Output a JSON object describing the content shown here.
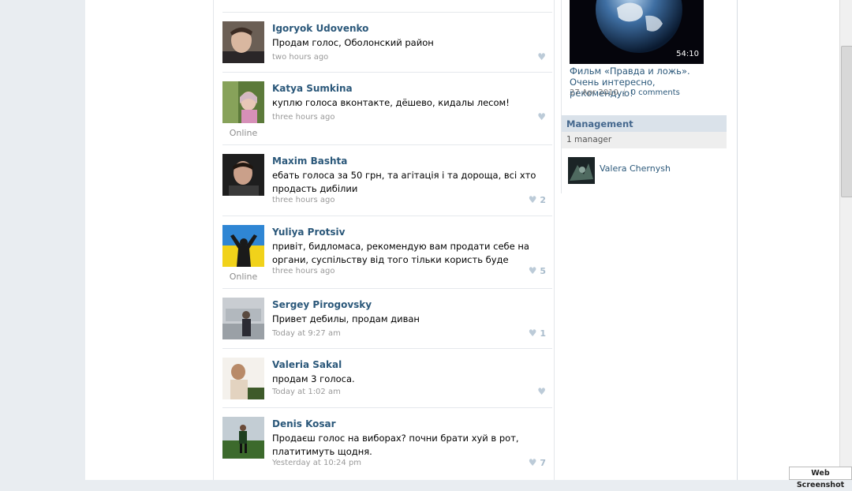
{
  "posts": [
    {
      "name": "Igoryok Udovenko",
      "text": "Продам голос, Оболонский район",
      "time": "two hours ago",
      "online": "",
      "likes": ""
    },
    {
      "name": "Katya Sumkina",
      "text": "куплю голоса вконтакте, дёшево, кидалы лесом!",
      "time": "three hours ago",
      "online": "Online",
      "likes": ""
    },
    {
      "name": "Maxim Bashta",
      "text": "ебать голоса за 50 грн, та агітація і та дороща, всі хто продасть дибілии",
      "time": "three hours ago",
      "online": "",
      "likes": "2"
    },
    {
      "name": "Yuliya Protsiv",
      "text": "привіт, бидломаса, рекомендую вам продати себе на органи, суспільству від того тільки користь буде",
      "time": "three hours ago",
      "online": "Online",
      "likes": "5"
    },
    {
      "name": "Sergey Pirogovsky",
      "text": "Привет дебилы, продам диван",
      "time": "Today at 9:27 am",
      "online": "",
      "likes": "1"
    },
    {
      "name": "Valeria Sakal",
      "text": "продам 3 голоса.",
      "time": "Today at 1:02 am",
      "online": "",
      "likes": ""
    },
    {
      "name": "Denis Kosar",
      "text": "Продаєш голос на виборах? почни брати хуй в рот, платитимуть щодня.",
      "time": "Yesterday at 10:24 pm",
      "online": "",
      "likes": "7"
    }
  ],
  "video": {
    "duration": "54:10",
    "title": "Фильм «Правда и ложь». Очень интересно, рекомендую!",
    "date": "27 Apr 2010",
    "separator": "|",
    "comments": "0 comments"
  },
  "management": {
    "title": "Management",
    "count": "1 manager",
    "manager_name": "Valera Chernysh"
  },
  "watermark": "Web Screenshot",
  "colors": {
    "link": "#2b587a",
    "header_bg": "#dae2ea",
    "muted": "#999999"
  }
}
